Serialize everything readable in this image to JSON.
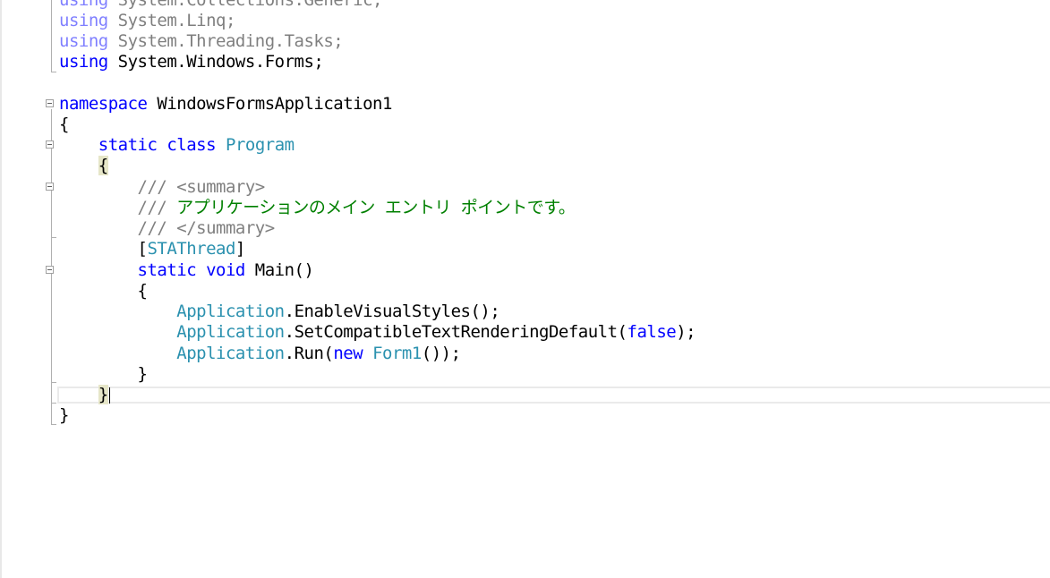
{
  "editor": {
    "lines": {
      "l0": {
        "kw": "using",
        "text": " System.Collections.Generic;"
      },
      "l1": {
        "kw": "using",
        "text": " System.Linq;"
      },
      "l2": {
        "kw": "using",
        "text": " System.Threading.Tasks;"
      },
      "l3": {
        "kw": "using",
        "text": " System.Windows.Forms;"
      },
      "l5": {
        "kw": "namespace",
        "text": " WindowsFormsApplication1"
      },
      "l6": {
        "text": "{"
      },
      "l7": {
        "indent": "    ",
        "kw": "static class",
        "type": "Program"
      },
      "l8": {
        "indent": "    ",
        "text": "{"
      },
      "l9": {
        "indent": "        ",
        "slashes": "///",
        "tag": " <summary>"
      },
      "l10": {
        "indent": "        ",
        "slashes": "///",
        "comment": " アプリケーションのメイン エントリ ポイントです。"
      },
      "l11": {
        "indent": "        ",
        "slashes": "///",
        "tag": " </summary>"
      },
      "l12": {
        "indent": "        ",
        "open": "[",
        "attr": "STAThread",
        "close": "]"
      },
      "l13": {
        "indent": "        ",
        "kw": "static void",
        "text": " Main()"
      },
      "l14": {
        "indent": "        ",
        "text": "{"
      },
      "l15": {
        "indent": "            ",
        "type": "Application",
        "text": ".EnableVisualStyles();"
      },
      "l16": {
        "indent": "            ",
        "type": "Application",
        "text": ".SetCompatibleTextRenderingDefault(",
        "kw2": "false",
        "text2": ");"
      },
      "l17": {
        "indent": "            ",
        "type": "Application",
        "text": ".Run(",
        "kw2": "new",
        "type2": " Form1",
        "text2": "());"
      },
      "l18": {
        "indent": "        ",
        "text": "}"
      },
      "l19": {
        "indent": "    ",
        "text": "}"
      },
      "l20": {
        "text": "}"
      }
    }
  }
}
